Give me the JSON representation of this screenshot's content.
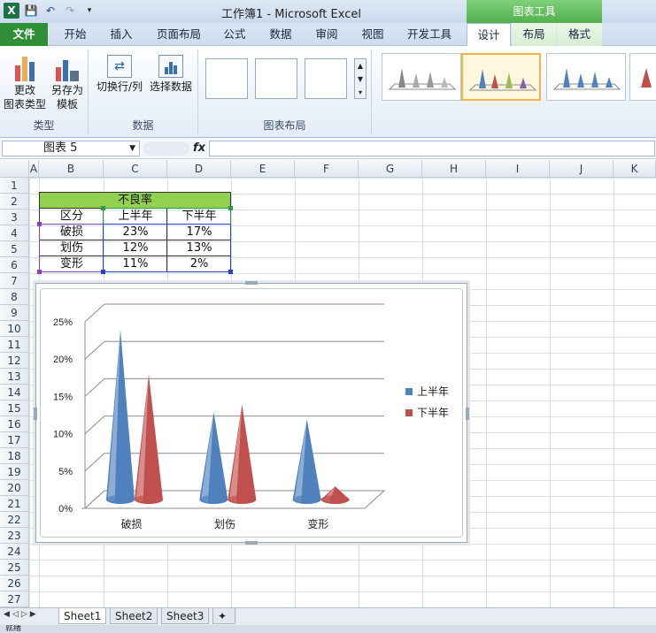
{
  "window": {
    "title": "工作簿1 - Microsoft Excel",
    "tools_tab": "图表工具"
  },
  "tabs": [
    {
      "label": "文件"
    },
    {
      "label": "开始"
    },
    {
      "label": "插入"
    },
    {
      "label": "页面布局"
    },
    {
      "label": "公式"
    },
    {
      "label": "数据"
    },
    {
      "label": "审阅"
    },
    {
      "label": "视图"
    },
    {
      "label": "开发工具"
    },
    {
      "label": "设计"
    },
    {
      "label": "布局"
    },
    {
      "label": "格式"
    }
  ],
  "ribbon": {
    "groups": {
      "type": "类型",
      "data": "数据",
      "layout": "图表布局"
    },
    "buttons": {
      "change_type_1": "更改",
      "change_type_2": "图表类型",
      "save_template_1": "另存为",
      "save_template_2": "模板",
      "switch_row_col": "切换行/列",
      "select_data": "选择数据"
    }
  },
  "formula_bar": {
    "name_box": "图表 5",
    "fx": "fx",
    "formula": ""
  },
  "columns": [
    "A",
    "B",
    "C",
    "D",
    "E",
    "F",
    "G",
    "H",
    "I",
    "J",
    "K"
  ],
  "rows": [
    "1",
    "2",
    "3",
    "4",
    "5",
    "6",
    "7",
    "8",
    "9",
    "10",
    "11",
    "12",
    "13",
    "14",
    "15",
    "16",
    "17",
    "18",
    "19",
    "20",
    "21",
    "22",
    "23",
    "24",
    "25",
    "26",
    "27"
  ],
  "table": {
    "title": "不良率",
    "headers": [
      "区分",
      "上半年",
      "下半年"
    ],
    "rows": [
      [
        "破损",
        "23%",
        "17%"
      ],
      [
        "划伤",
        "12%",
        "13%"
      ],
      [
        "变形",
        "11%",
        "2%"
      ]
    ]
  },
  "chart_data": {
    "type": "bar",
    "categories": [
      "破损",
      "划伤",
      "变形"
    ],
    "series": [
      {
        "name": "上半年",
        "values": [
          23,
          12,
          11
        ],
        "color": "#4f81bd"
      },
      {
        "name": "下半年",
        "values": [
          17,
          13,
          2
        ],
        "color": "#c0504d"
      }
    ],
    "yticks": [
      "0%",
      "5%",
      "10%",
      "15%",
      "20%",
      "25%"
    ],
    "ylim": [
      0,
      25
    ],
    "grid": true,
    "legend": "right"
  },
  "sheets": [
    {
      "label": "Sheet1"
    },
    {
      "label": "Sheet2"
    },
    {
      "label": "Sheet3"
    }
  ],
  "status": {
    "mode": "就绪"
  }
}
